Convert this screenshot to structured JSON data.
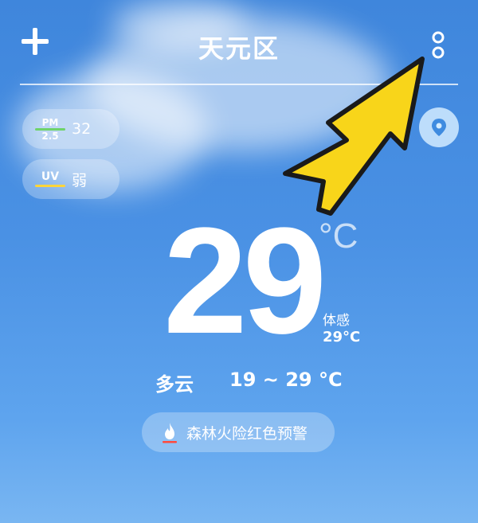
{
  "header": {
    "location": "天元区",
    "add_icon": "plus-icon",
    "more_icon": "more-vertical-icon"
  },
  "air": {
    "pm_label_top": "PM",
    "pm_label_bottom": "2.5",
    "pm_value": "32",
    "uv_label": "UV",
    "uv_value": "弱"
  },
  "weather": {
    "temperature": "29",
    "unit": "°C",
    "feels_label": "体感",
    "feels_value": "29°C",
    "condition": "多云",
    "range": "19 ~ 29 °C"
  },
  "alert": {
    "text": "森林火险红色预警",
    "icon": "fire-icon"
  },
  "map_icon": "map-pin-icon",
  "colors": {
    "arrow_fill": "#f8d51a",
    "uv_bar": "#ffd53a",
    "pm_bar": "#6fd36a",
    "alert_icon": "#ff4a3d"
  }
}
